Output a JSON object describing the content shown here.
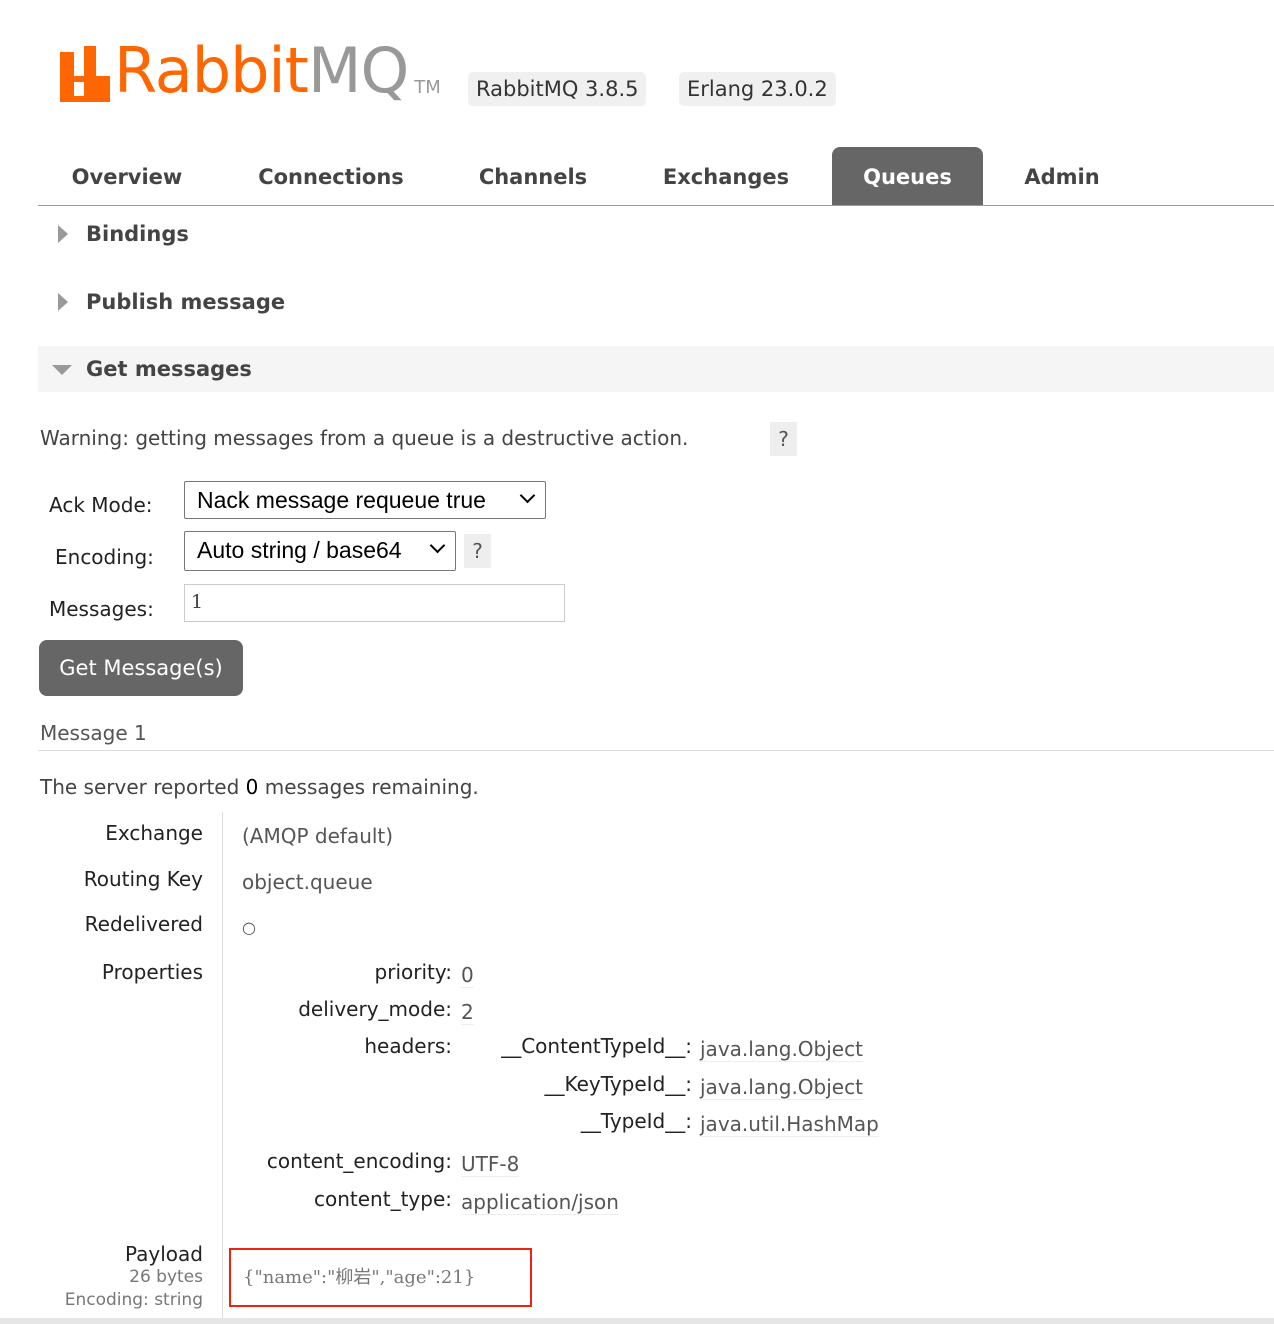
{
  "brand": {
    "name_orange": "Rabbit",
    "name_grey": "MQ",
    "tm": "TM",
    "version": "RabbitMQ 3.8.5",
    "erlang": "Erlang 23.0.2"
  },
  "tabs": [
    "Overview",
    "Connections",
    "Channels",
    "Exchanges",
    "Queues",
    "Admin"
  ],
  "active_tab": "Queues",
  "sections": {
    "bindings": "Bindings",
    "publish": "Publish message",
    "get": "Get messages"
  },
  "get_messages": {
    "warning": "Warning: getting messages from a queue is a destructive action.",
    "help": "?",
    "ack_mode_label": "Ack Mode:",
    "ack_mode_value": "Nack message requeue true",
    "encoding_label": "Encoding:",
    "encoding_value": "Auto string / base64",
    "messages_label": "Messages:",
    "messages_value": "1",
    "button": "Get Message(s)"
  },
  "message": {
    "heading": "Message 1",
    "remaining_prefix": "The server reported",
    "remaining_count": "0",
    "remaining_suffix": "messages remaining.",
    "exchange_label": "Exchange",
    "exchange_value": "(AMQP default)",
    "routing_key_label": "Routing Key",
    "routing_key_value": "object.queue",
    "redelivered_label": "Redelivered",
    "redelivered_value": "○",
    "properties_label": "Properties",
    "properties": {
      "priority_label": "priority:",
      "priority": "0",
      "delivery_mode_label": "delivery_mode:",
      "delivery_mode": "2",
      "headers_label": "headers:",
      "headers": [
        {
          "key": "__ContentTypeId__:",
          "value": "java.lang.Object"
        },
        {
          "key": "__KeyTypeId__:",
          "value": "java.lang.Object"
        },
        {
          "key": "__TypeId__:",
          "value": "java.util.HashMap"
        }
      ],
      "content_encoding_label": "content_encoding:",
      "content_encoding": "UTF-8",
      "content_type_label": "content_type:",
      "content_type": "application/json"
    },
    "payload_label": "Payload",
    "payload_size": "26 bytes",
    "payload_encoding": "Encoding: string",
    "payload": "{\"name\":\"柳岩\",\"age\":21}"
  }
}
